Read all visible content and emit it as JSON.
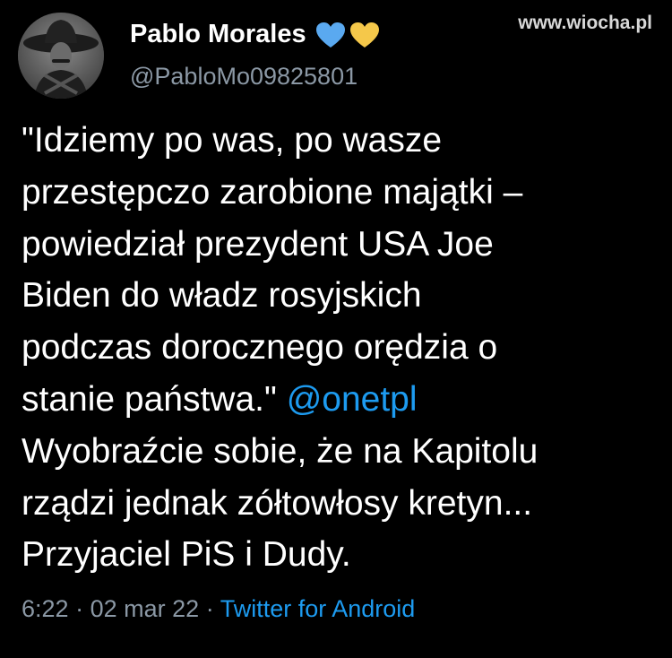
{
  "tweet": {
    "author": {
      "display_name": "Pablo Morales",
      "handle": "@PabloMo09825801",
      "avatar": "portrait-avatar",
      "badges": [
        {
          "icon": "blue-heart-icon",
          "color": "#5aa9f0"
        },
        {
          "icon": "yellow-heart-icon",
          "color": "#f5c84a"
        }
      ]
    },
    "text_lines": [
      "\"Idziemy po was, po wasze",
      "przestępczo zarobione majątki –",
      "powiedział prezydent USA Joe",
      "Biden do władz rosyjskich",
      "podczas dorocznego orędzia o",
      "stanie państwa.\" ",
      "Wyobraźcie sobie, że na Kapitolu",
      "rządzi jednak zółtowłosy kretyn...",
      "Przyjaciel PiS i Dudy."
    ],
    "mention": "@onetpl",
    "time": "6:22",
    "separator": "·",
    "date": "02 mar 22",
    "source": "Twitter for Android"
  },
  "watermark": "www.wiocha.pl",
  "colors": {
    "background": "#000000",
    "text": "#ffffff",
    "secondary": "#8b98a5",
    "link": "#1d9bf0"
  }
}
